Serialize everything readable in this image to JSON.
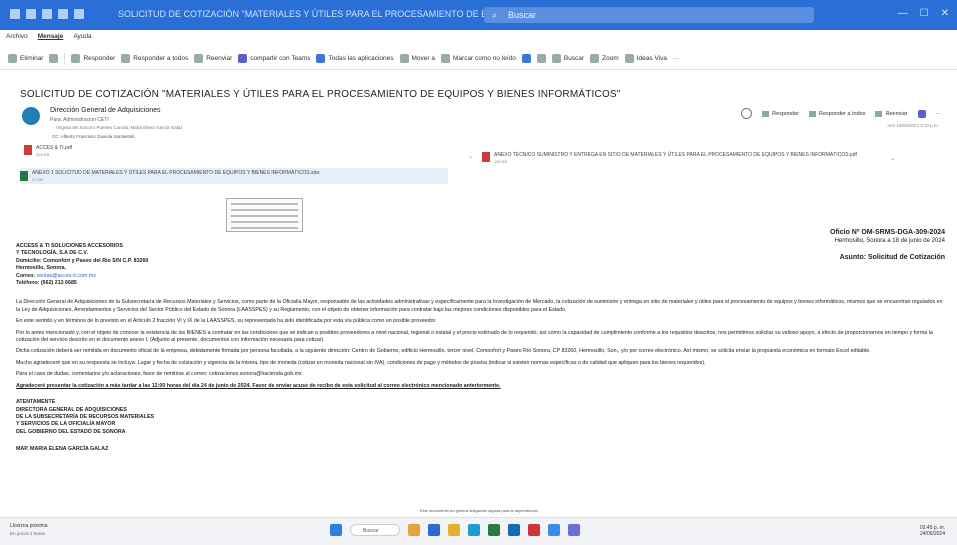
{
  "titlebar": {
    "title": "SOLICITUD DE COTIZACIÓN \"MATERIALES Y ÚTILES PARA EL PROCESAMIENTO DE EQUIPOS...\"  -  Mensaje",
    "search_placeholder": "Buscar"
  },
  "menu": [
    "Archivo",
    "Mensaje",
    "Ayuda"
  ],
  "ribbon": {
    "eliminar": "Eliminar",
    "responder": "Responder",
    "responder_todos": "Responder a todos",
    "reenviar": "Reenviar",
    "teams": "compartir con Teams",
    "todas_apps": "Todas las aplicaciones",
    "mover": "Mover a",
    "marcar": "Marcar como no leído",
    "buscar": "Buscar",
    "zoom": "Zoom",
    "ideas": "Ideas Viva"
  },
  "email": {
    "subject": "SOLICITUD DE COTIZACIÓN \"MATERIALES Y ÚTILES PARA EL PROCESAMIENTO DE EQUIPOS Y BIENES INFORMÁTICOS\"",
    "sender": "Dirección General de Adquisiciones",
    "to": "Para: Administracion CETI",
    "cc1": "Virginia del Socorro Puertes Carrala; María Elena García Galaz",
    "cc2": "CC: Alberto Francisco Gaxiola Santiesteb",
    "actions": {
      "responder": "Responder",
      "responder_todos": "Responder a todos",
      "reenviar": "Reenviar"
    },
    "datetime": "mar 18/06/2024 2:10 p.m."
  },
  "attachments": [
    {
      "name": "ACCES & TI.pdf",
      "size": "393 KB"
    },
    {
      "name": "ANEXO TÉCNICO SUMINISTRO Y ENTREGA EN SITIO DE MATERIALES Y ÚTILES PARA EL PROCESAMIENTO DE EQUIPOS Y BIENES INFORMÁTICOS.pdf",
      "size": "165 KB"
    },
    {
      "name": "ANEXO 1 SOLICITUD DE MATERIALES Y ÚTILES PARA EL PROCESAMIENTO DE EQUIPOS Y BIENES INFORMÁTICOS.xlsx",
      "size": "47 KB"
    }
  ],
  "letter": {
    "oficio": "Oficio Nº OM-SRMS-DGA-309-2024",
    "fecha": "Hermosillo, Sonora a 18 de junio de 2024",
    "asunto": "Asunto: Solicitud de Cotización",
    "dest1": "ACCESS & TI SOLUCIONES ACCESORIOS",
    "dest2": "Y TECNOLOGÍA, S.A DE C.V.",
    "domicilio": "Domicilio: Comonfort y Paseo del Río S/N C.P. 83260",
    "ciudad": "Hermosillo, Sonora.",
    "correo_label": "Correo:",
    "correo": "ventas@acces-ti.com.mx",
    "telefono": "Teléfono: (662) 213 6685",
    "p1": "La Dirección General de Adquisiciones de la Subsecretaría de Recursos Materiales y Servicios, como parte de la Oficialía Mayor, responsable de las actividades administrativas y específicamente para la Investigación de Mercado, la cotización de suministro y entrega en sitio de materiales y útiles para el procesamiento de equipos y bienes informáticos, mismos que se encuentran regulados en la Ley de Adquisiciones, Arrendamientos y Servicios del Sector Público del Estado de Sonora (LAASSPES) y su Reglamento, con el objeto de obtener información para contratar bajo las mejores condiciones disponibles para el Estado.",
    "p2": "En este sentido y en términos de lo previsto en el Artículo 2 fracción VI y IX de la LAASSPES, su representada ha sido identificada por esta vía pública como un posible proveedor.",
    "p3": "Por lo antes mencionado y, con el objeto de conocer la existencia de los BIENES a contratar en las condiciones que se indican a posibles proveedores a nivel nacional, regional o estatal y el precio estimado de lo requerido, así como la capacidad de cumplimiento conforme a los requisitos descritos, nos permitimos solicitar su valioso apoyo, a efecto de proporcionarnos en tiempo y forma la cotización del servicio descrito en el documento anexo I. (Adjunto al presente, documentos con información necesaria para cotizar).",
    "p4": "Dicha cotización deberá ser remitida en documento oficial de la empresa, debidamente firmada por persona facultada, a la siguiente dirección: Centro de Gobierno, edificio Hermosillo, tercer nivel, Comonfort y Paseo Río Sonora, CP 83260, Hermosillo, Son., y/o por correo electrónico. Así mismo, se solicita enviar la propuesta económica en formato Excel editable.",
    "p5": "Mucho agradeceré que en su respuesta se incluya: Lugar y fecha de cotización y vigencia de la misma, tipo de moneda (cotizar en moneda nacional sin IVA), condiciones de pago y métodos de prueba (indicar si existen normas específicas o de calidad que apliquen para los bienes requeridos).",
    "p6": "Para el caso de dudas, comentarios y/o aclaraciones, favor de remitirse al correo: cotizaciones.sonora@hacienda.gob.mx",
    "p7": "Agradeceré presentar la cotización a más tardar a las 12:00 horas del día 24 de junio de 2024. Favor de enviar acuse de recibo de esta solicitud al correo electrónico mencionado anteriormente.",
    "firma": [
      "ATENTAMENTE",
      "DIRECTORA GENERAL DE ADQUISICIONES",
      "DE LA SUBSECRETARÍA DE RECURSOS MATERIALES",
      "Y SERVICIOS DE LA OFICIALÍA MAYOR",
      "DEL GOBIERNO DEL ESTADO DE SONORA"
    ],
    "nombre": "MAP. MARIA ELENA GARCÍA GALAZ",
    "footer": "Este documento no genera obligación alguna para la dependencia"
  },
  "taskbar": {
    "weather": "Llovizna próxima",
    "temp": "En pocos 2 horas",
    "search": "Buscar",
    "time": "02:45 p. m.",
    "date": "24/06/2024"
  }
}
